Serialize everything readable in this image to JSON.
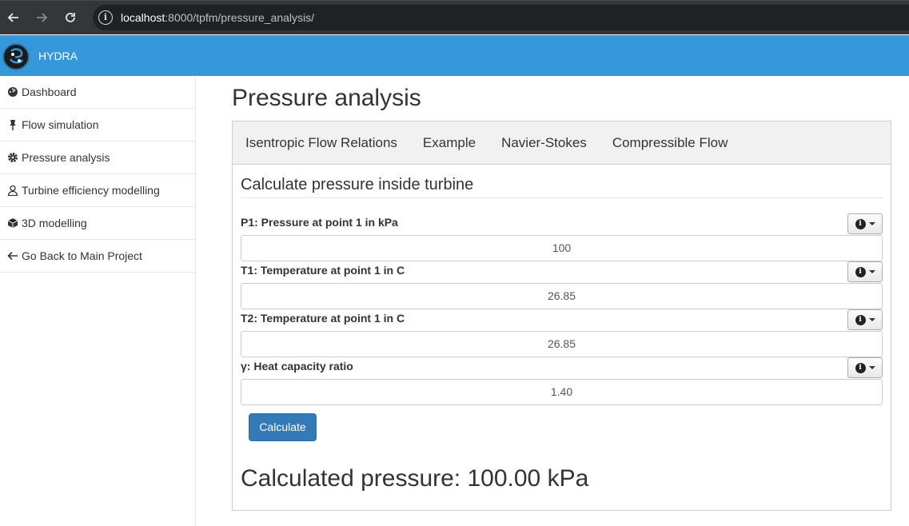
{
  "browser": {
    "url_host": "localhost",
    "url_path": ":8000/tpfm/pressure_analysis/"
  },
  "app": {
    "brand": "HYDRA"
  },
  "sidebar": {
    "items": [
      {
        "label": "Dashboard",
        "icon": "dashboard-icon"
      },
      {
        "label": "Flow simulation",
        "icon": "pushpin-icon"
      },
      {
        "label": "Pressure analysis",
        "icon": "gear-icon"
      },
      {
        "label": "Turbine efficiency modelling",
        "icon": "user-icon"
      },
      {
        "label": "3D modelling",
        "icon": "cube-icon"
      },
      {
        "label": "Go Back to Main Project",
        "icon": "arrow-left-icon"
      }
    ]
  },
  "main": {
    "title": "Pressure analysis",
    "tabs": [
      {
        "label": "Isentropic Flow Relations"
      },
      {
        "label": "Example"
      },
      {
        "label": "Navier-Stokes"
      },
      {
        "label": "Compressible Flow"
      }
    ],
    "section_title": "Calculate pressure inside turbine",
    "fields": [
      {
        "label": "P1: Pressure at point 1 in kPa",
        "value": "100"
      },
      {
        "label": "T1: Temperature at point 1 in C",
        "value": "26.85"
      },
      {
        "label": "T2: Temperature at point 1 in C",
        "value": "26.85"
      },
      {
        "label": "γ: Heat capacity ratio",
        "value": "1.40"
      }
    ],
    "calculate_label": "Calculate",
    "result_text": "Calculated pressure: 100.00 kPa"
  },
  "colors": {
    "header": "#3498db",
    "button": "#337ab7"
  }
}
